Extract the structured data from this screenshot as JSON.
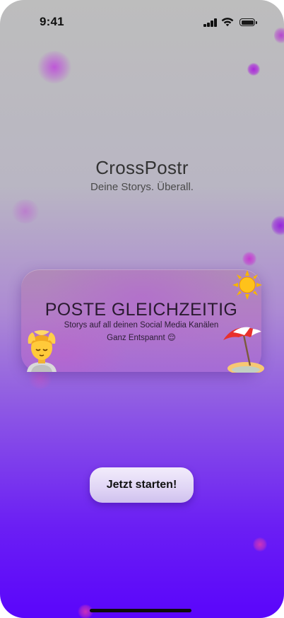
{
  "status_bar": {
    "time": "9:41",
    "icons": [
      "cellular-signal-icon",
      "wifi-icon",
      "battery-icon"
    ]
  },
  "header": {
    "app_name": "CrossPostr",
    "tagline": "Deine Storys. Überall."
  },
  "feature_card": {
    "headline": "POSTE GLEICHZEITIG",
    "line1": "Storys auf all deinen Social Media Kanälen",
    "line2": "Ganz Entspannt 😌",
    "icons": [
      "sun-icon",
      "beach-umbrella-icon",
      "relaxing-person-icon"
    ]
  },
  "cta": {
    "label": "Jetzt starten!"
  },
  "colors": {
    "background_top": "#bdbdbd",
    "background_bottom": "#5a05fb",
    "card": "#b27bc8",
    "button": "#e0d5f5",
    "text_dark": "#333333"
  }
}
